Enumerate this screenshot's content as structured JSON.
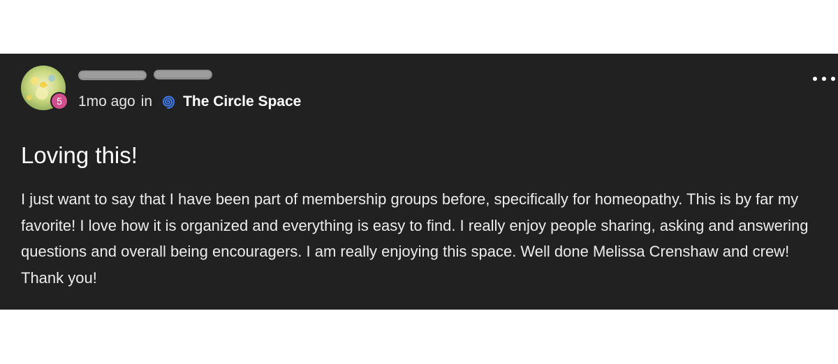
{
  "post": {
    "level": "5",
    "time": "1mo ago",
    "in_label": "in",
    "space_name": "The Circle Space",
    "space_icon": "spiral-icon",
    "title": "Loving this!",
    "body": "I just want to say that I have been part of membership groups before, specifically for homeopathy. This is by far my favorite! I love how it is organized and everything is easy to find. I really enjoy people sharing, asking and answering questions and overall being encouragers. I am really enjoying this space. Well done Melissa Crenshaw and crew! Thank you!",
    "badge_color": "#d14f8d",
    "space_icon_color": "#3f7bea"
  }
}
